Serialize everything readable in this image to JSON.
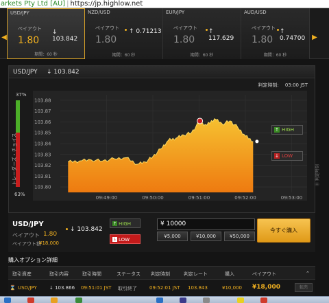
{
  "browser": {
    "cert_label": "arkets Pty Ltd [AU]",
    "separator": "|",
    "url": "https://jp.highlow.net"
  },
  "tiles": [
    {
      "pair": "USD/JPY",
      "payout_label": "ペイアウト",
      "payout": "1.80",
      "rate": "103.842",
      "direction": "down",
      "period": "期間：60 秒",
      "active": true
    },
    {
      "pair": "NZD/USD",
      "payout_label": "ペイアウト",
      "payout": "1.80",
      "rate": "0.71213",
      "direction": "up",
      "period": "期間：60 秒",
      "active": false
    },
    {
      "pair": "EUR/JPY",
      "payout_label": "ペイアウト",
      "payout": "1.80",
      "rate": "117.629",
      "direction": "up",
      "period": "期間：60 秒",
      "active": false
    },
    {
      "pair": "AUD/USD",
      "payout_label": "ペイアウト",
      "payout": "1.80",
      "rate": "0.74700",
      "direction": "up",
      "period": "期間：60 秒",
      "active": false
    }
  ],
  "panel": {
    "pair": "USD/JPY",
    "rate": "↓ 103.842",
    "judge_label": "判定時刻:",
    "judge_time": "03:00 JST",
    "sentiment_top": "37%",
    "sentiment_bottom": "63%",
    "sentiment_label": "トレーダーズ・チョイス",
    "right_label": "⓪ 判定時刻"
  },
  "chart_data": {
    "type": "area",
    "y_ticks": [
      "103.88",
      "103.87",
      "103.86",
      "103.85",
      "103.84",
      "103.83",
      "103.82",
      "103.81",
      "103.80"
    ],
    "x_ticks": [
      "09:49:00",
      "09:50:00",
      "09:51:00",
      "09:52:00",
      "09:53:00"
    ],
    "ylim": [
      103.795,
      103.885
    ],
    "x": [
      "09:48:10",
      "09:48:25",
      "09:48:40",
      "09:48:55",
      "09:49:10",
      "09:49:25",
      "09:49:40",
      "09:49:50",
      "09:50:00",
      "09:50:10",
      "09:50:20",
      "09:50:30",
      "09:50:40",
      "09:50:50",
      "09:51:00",
      "09:51:10",
      "09:51:20",
      "09:51:30",
      "09:51:40",
      "09:51:50",
      "09:52:00",
      "09:52:10"
    ],
    "values": [
      103.823,
      103.824,
      103.825,
      103.824,
      103.826,
      103.827,
      103.821,
      103.823,
      103.828,
      103.835,
      103.843,
      103.845,
      103.848,
      103.85,
      103.86,
      103.857,
      103.863,
      103.858,
      103.861,
      103.855,
      103.847,
      103.842
    ],
    "entry_marker": {
      "x": "09:51:01",
      "y": 103.866
    },
    "current_marker": {
      "x": "09:52:15",
      "y": 103.842
    },
    "buttons": {
      "high": "HIGH",
      "low": "LOW"
    }
  },
  "order": {
    "pair": "USD/JPY",
    "rate": "103.842",
    "payout_label": "ペイアウト",
    "payout": "1.80",
    "amount_label": "ペイアウト額",
    "amount": "¥18,000",
    "high_label": "HIGH",
    "low_label": "LOW",
    "investment": "¥ 10000",
    "amount_buttons": [
      "¥5,000",
      "¥10,000",
      "¥50,000"
    ],
    "buy_label": "今すぐ購入"
  },
  "details": {
    "title": "購入オプション詳細",
    "headers": [
      "取引資産",
      "取引内容",
      "取引時間",
      "ステータス",
      "判定時刻",
      "判定レート",
      "購入",
      "ペイアウト"
    ],
    "row": {
      "asset": "USD/JPY",
      "content": "↓ 103.866",
      "time": "09:51:01 JST",
      "status": "取引終了",
      "judge_time": "09:52:01 JST",
      "judge_rate": "103.843",
      "purchase": "¥10,000",
      "payout": "¥18,000",
      "sell": "転売"
    }
  }
}
